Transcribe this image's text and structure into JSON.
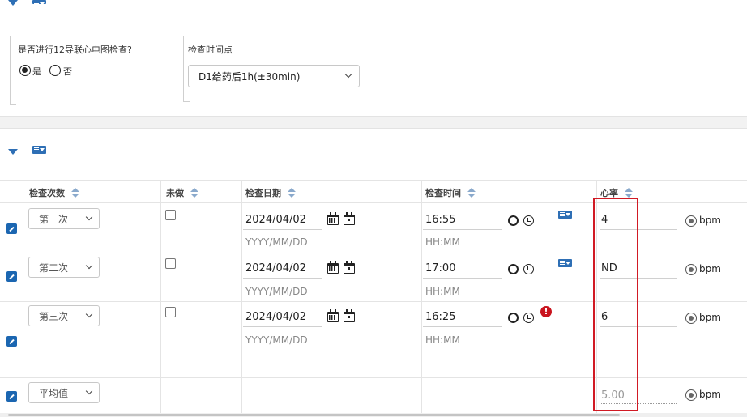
{
  "section1": {
    "question": "是否进行12导联心电图检查?",
    "options": [
      "是",
      "否"
    ],
    "selected": "是",
    "timepoint_label": "检查时间点",
    "timepoint_value": "D1给药后1h(±30min)"
  },
  "table": {
    "headers": {
      "count": "检查次数",
      "not_done": "未做",
      "date": "检查日期",
      "time": "检查时间",
      "hr": "心率"
    },
    "rows": [
      {
        "count": "第一次",
        "date": "2024/04/02",
        "date_hint": "YYYY/MM/DD",
        "time": "16:55",
        "time_hint": "HH:MM",
        "hr": "4",
        "unit": "bpm"
      },
      {
        "count": "第二次",
        "date": "2024/04/02",
        "date_hint": "YYYY/MM/DD",
        "time": "17:00",
        "time_hint": "HH:MM",
        "hr": "ND",
        "unit": "bpm"
      },
      {
        "count": "第三次",
        "date": "2024/04/02",
        "date_hint": "YYYY/MM/DD",
        "time": "16:25",
        "time_hint": "HH:MM",
        "hr": "6",
        "unit": "bpm"
      }
    ],
    "average": {
      "count": "平均值",
      "hr": "5.00",
      "unit": "bpm"
    }
  },
  "colors": {
    "accent": "#2e6fb5",
    "highlight": "#d11a24",
    "warning": "#c9141e"
  }
}
